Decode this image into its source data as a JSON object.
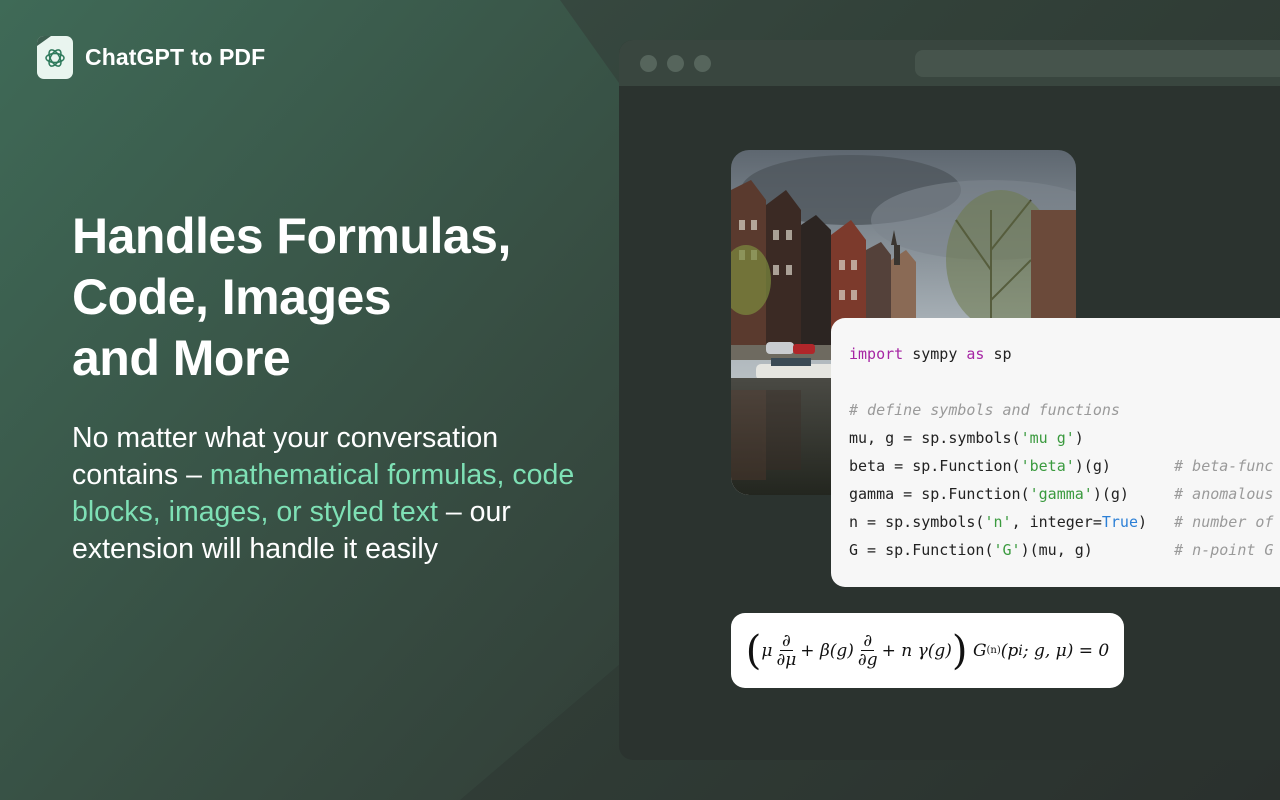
{
  "brand": {
    "name": "ChatGPT to PDF",
    "icon": "openai-knot-icon"
  },
  "headline": {
    "line1": "Handles Formulas,",
    "line2": "Code, Images",
    "line3": "and More"
  },
  "description": {
    "part1": "No matter what your conversation contains – ",
    "highlight": "mathematical formulas, code blocks, images, or styled text",
    "part2": " – our extension will handle it easily"
  },
  "colors": {
    "accent": "#7ee0b5",
    "background_dark": "#2b332f",
    "keyword": "#a626a4",
    "string": "#3a9a3e",
    "comment": "#9a9a9a",
    "boolean": "#2b7fd6"
  },
  "code": {
    "l1_kw1": "import",
    "l1_mid": " sympy ",
    "l1_kw2": "as",
    "l1_end": " sp",
    "l3": "# define symbols and functions",
    "l4_a": "mu, g = sp.symbols(",
    "l4_s": "'mu g'",
    "l4_b": ")",
    "l5_a": "beta = sp.Function(",
    "l5_s": "'beta'",
    "l5_b": ")(g)       ",
    "l5_c": "# beta-func",
    "l6_a": "gamma = sp.Function(",
    "l6_s": "'gamma'",
    "l6_b": ")(g)     ",
    "l6_c": "# anomalous",
    "l7_a": "n = sp.symbols(",
    "l7_s": "'n'",
    "l7_b": ", integer=",
    "l7_t": "True",
    "l7_e": ")   ",
    "l7_c": "# number of",
    "l8_a": "G = sp.Function(",
    "l8_s": "'G'",
    "l8_b": ")(mu, g)         ",
    "l8_c": "# n-point G"
  },
  "formula": {
    "mu": "μ",
    "d": "∂",
    "dmu": "∂μ",
    "plus_beta": "+ β(g)",
    "dg": "∂g",
    "plus_ngamma": "+ n γ(g)",
    "G": "G",
    "sup": "(n)",
    "args": "(p",
    "sub": "i",
    "args2": "; g, μ)  =  0"
  }
}
